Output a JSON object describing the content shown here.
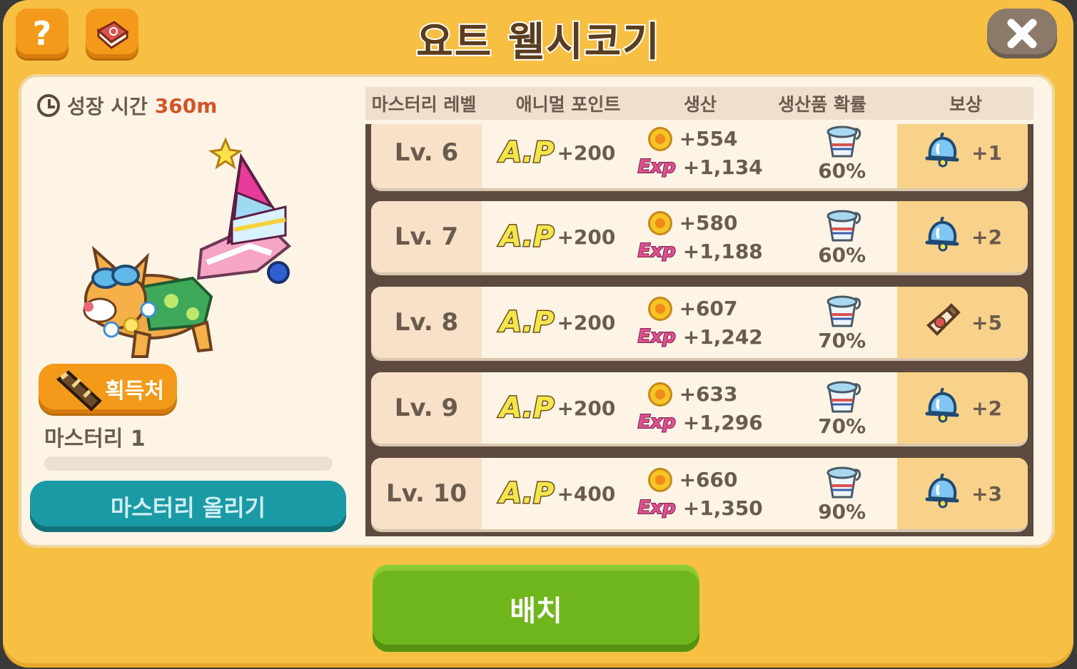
{
  "header": {
    "title": "요트 웰시코기"
  },
  "left": {
    "growth_label": "성장 시간",
    "growth_value": "360m",
    "obtain_label": "획득처",
    "mastery_name": "마스터리 1",
    "mastery_progress": 0,
    "upgrade_label": "마스터리 올리기"
  },
  "table": {
    "headers": [
      "마스터리 레벨",
      "애니멀 포인트",
      "생산",
      "생산품 확률",
      "보상"
    ],
    "ap_logo": "A.P",
    "exp_logo": "Exp",
    "rows": [
      {
        "level": "Lv. 6",
        "ap": "+200",
        "coin": "+554",
        "exp": "+1,134",
        "prob": "60%",
        "reward_icon": "bell-icon",
        "reward": "+1"
      },
      {
        "level": "Lv. 7",
        "ap": "+200",
        "coin": "+580",
        "exp": "+1,188",
        "prob": "60%",
        "reward_icon": "bell-icon",
        "reward": "+2"
      },
      {
        "level": "Lv. 8",
        "ap": "+200",
        "coin": "+607",
        "exp": "+1,242",
        "prob": "70%",
        "reward_icon": "bottle-icon",
        "reward": "+5"
      },
      {
        "level": "Lv. 9",
        "ap": "+200",
        "coin": "+633",
        "exp": "+1,296",
        "prob": "70%",
        "reward_icon": "bell-icon",
        "reward": "+2"
      },
      {
        "level": "Lv. 10",
        "ap": "+400",
        "coin": "+660",
        "exp": "+1,350",
        "prob": "90%",
        "reward_icon": "bell-icon",
        "reward": "+3"
      }
    ]
  },
  "footer": {
    "place_label": "배치"
  }
}
